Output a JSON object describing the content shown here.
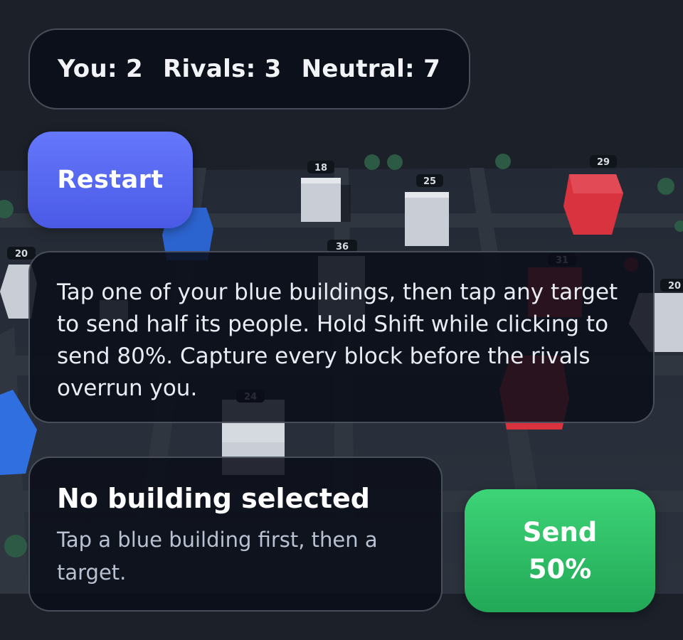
{
  "scoreboard": {
    "you": "You: 2",
    "rivals": "Rivals: 3",
    "neutral": "Neutral: 7"
  },
  "controls": {
    "restart_label": "Restart",
    "send_label": "Send 50%"
  },
  "instructions": {
    "text": "Tap one of your blue buildings, then tap any target to send half its people. Hold Shift while clicking to send 80%. Capture every block before the rivals overrun you."
  },
  "selection": {
    "title": "No building selected",
    "hint": "Tap a blue building first, then a target."
  },
  "map": {
    "building_counts": [
      "18",
      "25",
      "29",
      "20",
      "36",
      "31",
      "20",
      "24"
    ],
    "colors": {
      "player": "#2f6fe0",
      "rival": "#e0323f",
      "neutral": "#cfd4dc",
      "tree": "#2c5a45"
    }
  }
}
